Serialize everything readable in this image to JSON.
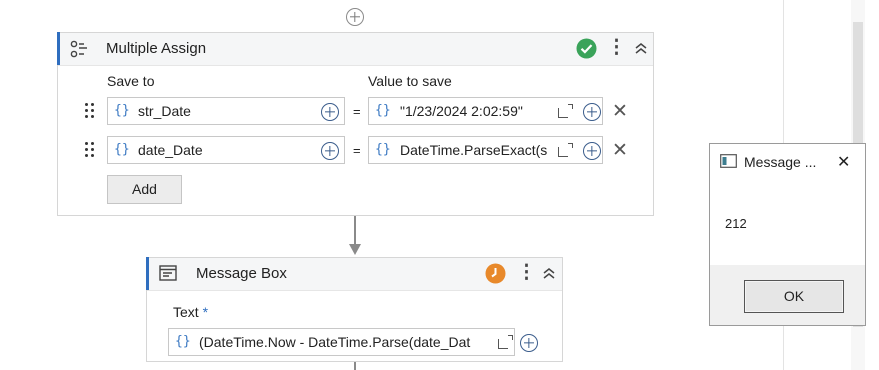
{
  "assign": {
    "title": "Multiple Assign",
    "save_to_label": "Save to",
    "value_label": "Value to save",
    "rows": [
      {
        "variable": "str_Date",
        "equals": "=",
        "value": "\"1/23/2024 2:02:59\""
      },
      {
        "variable": "date_Date",
        "equals": "=",
        "value": "DateTime.ParseExact(s"
      }
    ],
    "add_label": "Add",
    "status_icon": "check-circle-icon",
    "status_color": "#3aa35a"
  },
  "message_box": {
    "title": "Message Box",
    "text_label": "Text",
    "required_mark": "*",
    "text_value": "(DateTime.Now - DateTime.Parse(date_Dat",
    "status_icon": "clock-icon",
    "status_color": "#e8892b"
  },
  "dialog": {
    "title": "Message ...",
    "message": "212",
    "ok_label": "OK"
  },
  "icons": {
    "more": "⋮",
    "collapse": "⌃",
    "close": "✕",
    "brace": "{}",
    "dialog_close": "✕"
  },
  "colors": {
    "accent": "#2f6ebf",
    "brace": "#3a78c2"
  }
}
